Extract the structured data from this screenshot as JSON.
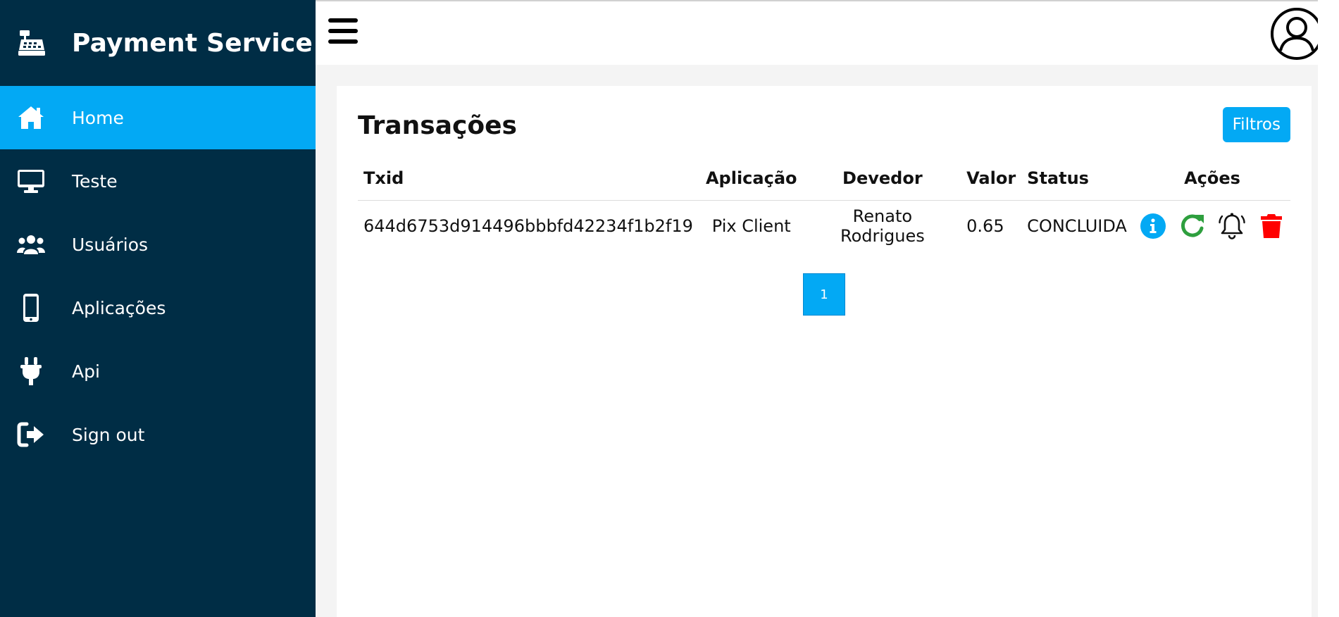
{
  "app": {
    "title": "Payment Service"
  },
  "sidebar": {
    "items": [
      {
        "label": "Home",
        "icon": "home-icon",
        "active": true
      },
      {
        "label": "Teste",
        "icon": "monitor-icon"
      },
      {
        "label": "Usuários",
        "icon": "users-icon"
      },
      {
        "label": "Aplicações",
        "icon": "mobile-icon"
      },
      {
        "label": "Api",
        "icon": "plug-icon"
      },
      {
        "label": "Sign out",
        "icon": "sign-out-icon"
      }
    ]
  },
  "page": {
    "title": "Transações",
    "filter_label": "Filtros"
  },
  "table": {
    "headers": {
      "txid": "Txid",
      "aplicacao": "Aplicação",
      "devedor": "Devedor",
      "valor": "Valor",
      "status": "Status",
      "acoes": "Ações"
    },
    "rows": [
      {
        "txid": "644d6753d914496bbbfd42234f1b2f19",
        "aplicacao": "Pix Client",
        "devedor": "Renato Rodrigues",
        "valor": "0.65",
        "status": "CONCLUIDA"
      }
    ]
  },
  "pagination": {
    "current": "1"
  },
  "colors": {
    "sidebar": "#002d45",
    "accent": "#03a9f4",
    "refresh": "#2e9f3e",
    "delete": "#ff0000"
  }
}
